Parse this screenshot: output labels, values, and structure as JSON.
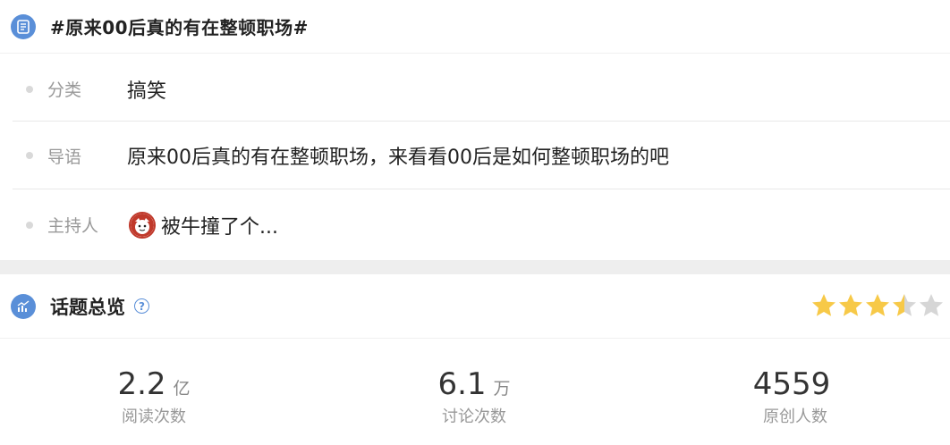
{
  "header": {
    "title": "#原来00后真的有在整顿职场#",
    "icon": "document-list-icon"
  },
  "info": {
    "category_label": "分类",
    "category_value": "搞笑",
    "intro_label": "导语",
    "intro_value": "原来00后真的有在整顿职场，来看看00后是如何整顿职场的吧",
    "host_label": "主持人",
    "host_name": "被牛撞了个..."
  },
  "overview": {
    "title": "话题总览",
    "help_icon": "question-circle-icon",
    "rating": 3.5,
    "rating_max": 5,
    "stats": [
      {
        "value": "2.2",
        "unit": "亿",
        "label": "阅读次数"
      },
      {
        "value": "6.1",
        "unit": "万",
        "label": "讨论次数"
      },
      {
        "value": "4559",
        "unit": "",
        "label": "原创人数"
      }
    ]
  },
  "colors": {
    "accent": "#5a8fd8",
    "star_on": "#f7c948",
    "star_off": "#d6d6d6"
  }
}
